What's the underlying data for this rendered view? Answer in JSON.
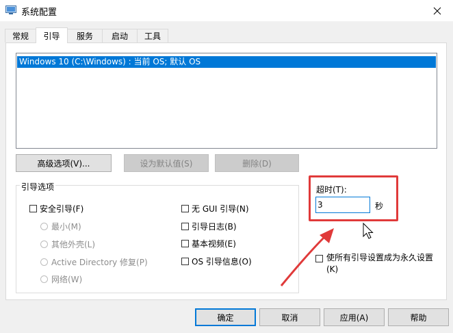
{
  "window": {
    "title": "系统配置"
  },
  "tabs": [
    {
      "label": "常规"
    },
    {
      "label": "引导"
    },
    {
      "label": "服务"
    },
    {
      "label": "启动"
    },
    {
      "label": "工具"
    }
  ],
  "os_list": [
    "Windows 10 (C:\\Windows) : 当前 OS; 默认 OS"
  ],
  "boot_buttons": {
    "advanced": "高级选项(V)...",
    "set_default": "设为默认值(S)",
    "delete": "删除(D)"
  },
  "boot_options": {
    "title": "引导选项",
    "safe_boot": "安全引导(F)",
    "minimal": "最小(M)",
    "alternate_shell": "其他外壳(L)",
    "ad_repair": "Active Directory 修复(P)",
    "network": "网络(W)",
    "no_gui": "无 GUI 引导(N)",
    "boot_log": "引导日志(B)",
    "base_video": "基本视频(E)",
    "os_boot_info": "OS 引导信息(O)"
  },
  "timeout": {
    "label": "超时(T):",
    "value": "3",
    "unit": "秒"
  },
  "permanent": {
    "label": "使所有引导设置成为永久设置(K)"
  },
  "footer": {
    "ok": "确定",
    "cancel": "取消",
    "apply": "应用(A)",
    "help": "帮助"
  },
  "colors": {
    "accent": "#0078d7",
    "annotation": "#e03a3a"
  }
}
